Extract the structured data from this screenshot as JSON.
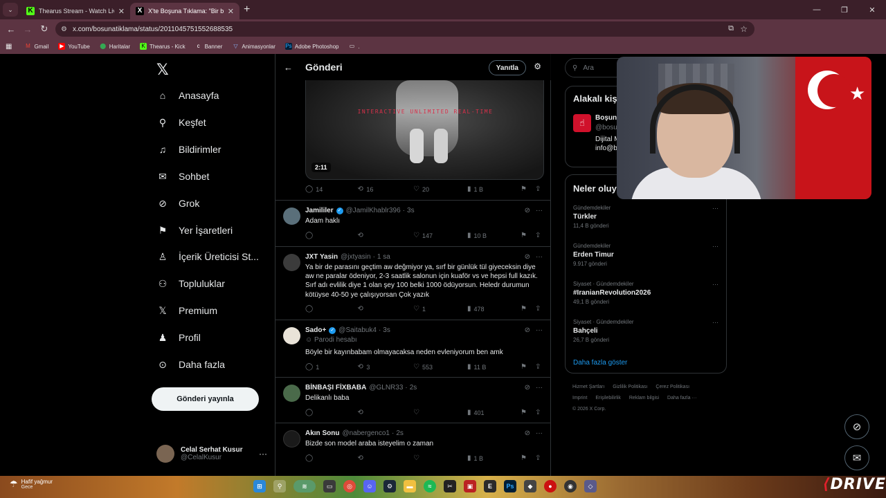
{
  "browser": {
    "tabs": [
      {
        "title": "Thearus Stream - Watch Live on Kick",
        "favicon": "kick-icon",
        "active": false
      },
      {
        "title": "X'te Boşuna Tıklama: \"Bir babam olmayacaksa\"",
        "favicon": "x-icon",
        "active": true
      }
    ],
    "new_tab": "+",
    "url": "x.com/bosunatiklama/status/2011045751552688535",
    "bookmarks": [
      {
        "label": "Gmail",
        "icon": "gmail-icon",
        "color": "#ea4335"
      },
      {
        "label": "YouTube",
        "icon": "youtube-icon",
        "color": "#ff0000"
      },
      {
        "label": "Haritalar",
        "icon": "maps-icon",
        "color": "#34a853"
      },
      {
        "label": "Thearus - Kick",
        "icon": "kick-icon",
        "color": "#53fc18"
      },
      {
        "label": "Banner",
        "icon": "banner-icon",
        "color": "#ffffff"
      },
      {
        "label": "Animasyonlar",
        "icon": "animation-icon",
        "color": "#8ab4f8"
      },
      {
        "label": "Adobe Photoshop",
        "icon": "photoshop-icon",
        "color": "#31a8ff"
      },
      {
        "label": ".",
        "icon": "folder-icon",
        "color": "#dddddd"
      }
    ]
  },
  "nav": {
    "items": [
      {
        "label": "Anasayfa",
        "icon": "home-icon",
        "glyph": "⌂"
      },
      {
        "label": "Keşfet",
        "icon": "search-icon",
        "glyph": "⚲"
      },
      {
        "label": "Bildirimler",
        "icon": "bell-icon",
        "glyph": "🔔"
      },
      {
        "label": "Sohbet",
        "icon": "mail-icon",
        "glyph": "✉"
      },
      {
        "label": "Grok",
        "icon": "grok-icon",
        "glyph": "⊘"
      },
      {
        "label": "Yer İşaretleri",
        "icon": "bookmark-icon",
        "glyph": "⚑"
      },
      {
        "label": "İçerik Üreticisi St...",
        "icon": "creator-icon",
        "glyph": "♙"
      },
      {
        "label": "Topluluklar",
        "icon": "communities-icon",
        "glyph": "⚇"
      },
      {
        "label": "Premium",
        "icon": "x-premium-icon",
        "glyph": "𝕏"
      },
      {
        "label": "Profil",
        "icon": "profile-icon",
        "glyph": "♟"
      },
      {
        "label": "Daha fazla",
        "icon": "more-icon",
        "glyph": "⋯"
      }
    ],
    "post_button": "Gönderi yayınla",
    "account": {
      "name": "Celal Serhat Kusur",
      "handle": "@CelalKusur"
    }
  },
  "feed": {
    "title": "Gönderi",
    "reply_button": "Yanıtla",
    "media": {
      "banner_text": "INTERACTIVE  UNLIMITED  REAL-TIME",
      "duration": "2:11"
    },
    "main_stats": {
      "replies": "14",
      "reposts": "16",
      "likes": "20",
      "views": "1 B"
    },
    "replies": [
      {
        "name": "Jamililer",
        "verified": true,
        "handle": "@JamilKhablr396",
        "time": "3s",
        "text": "Adam haklı",
        "replies": "",
        "reposts": "",
        "likes": "147",
        "views": "10 B",
        "avatar": "#5a6f7a"
      },
      {
        "name": "JXT Yasin",
        "verified": false,
        "handle": "@jxtyasin",
        "time": "1 sa",
        "text": "Ya bir de parasını geçtim aw değmiyor ya, sırf bir günlük tül giyeceksin diye aw ne paralar ödeniyor, 2-3 saatlik salonun için kuaför vs ve hepsi full kazık. Sırf adı evlilik diye 1 olan şey 100 belki 1000 ödüyorsun. Heledr durumun kötüyse 40-50 ye çalışıyorsan Çok yazık",
        "replies": "",
        "reposts": "",
        "likes": "1",
        "views": "478",
        "avatar": "#3b3b3b"
      },
      {
        "name": "Sado+",
        "verified": true,
        "handle": "@Saitabuk4",
        "time": "3s",
        "subtitle": "Parodi hesabı",
        "text": "Böyle bir kayınbabam olmayacaksa neden evleniyorum ben amk",
        "replies": "1",
        "reposts": "3",
        "likes": "553",
        "views": "11 B",
        "avatar": "#e9e3d8"
      },
      {
        "name": "BİNBAŞI FİXBABA",
        "verified": false,
        "handle": "@GLNR33",
        "time": "2s",
        "text": "Delikanlı baba",
        "replies": "",
        "reposts": "",
        "likes": "",
        "views": "401",
        "avatar": "#4a6a4a"
      },
      {
        "name": "Akın Sonu",
        "verified": false,
        "handle": "@nabergenco1",
        "time": "2s",
        "text": "Bizde son model araba isteyelim o zaman",
        "replies": "",
        "reposts": "",
        "likes": "",
        "views": "1 B",
        "avatar": "#1a1a1a"
      }
    ]
  },
  "sidebar": {
    "search_placeholder": "Ara",
    "related_title": "Alakalı kişiler",
    "related": {
      "name": "Boşuna Tıklama",
      "handle": "@bosunatiklama",
      "bio": "Dijital Medya. Boşuna tıkla ta... info@bosunatiklama"
    },
    "trends_title": "Neler oluyor",
    "trends": [
      {
        "category": "Gündemdekiler",
        "name": "Türkler",
        "posts": "11,4 B gönderi"
      },
      {
        "category": "Gündemdekiler",
        "name": "Erden Timur",
        "posts": "9.917 gönderi"
      },
      {
        "category": "Siyaset · Gündemdekiler",
        "name": "#IranianRevolution2026",
        "posts": "49,1 B gönderi"
      },
      {
        "category": "Siyaset · Gündemdekiler",
        "name": "Bahçeli",
        "posts": "26,7 B gönderi"
      }
    ],
    "show_more": "Daha fazla göster",
    "footer": [
      "Hizmet Şartları",
      "Gizlilik Politikası",
      "Çerez Politikası",
      "Imprint",
      "Erişilebilirlik",
      "Reklam bilgisi",
      "Daha fazla ···",
      "© 2026 X Corp."
    ]
  },
  "taskbar": {
    "weather_title": "Hafif yağmur",
    "weather_sub": "Gece",
    "brand": "DRIVE"
  }
}
